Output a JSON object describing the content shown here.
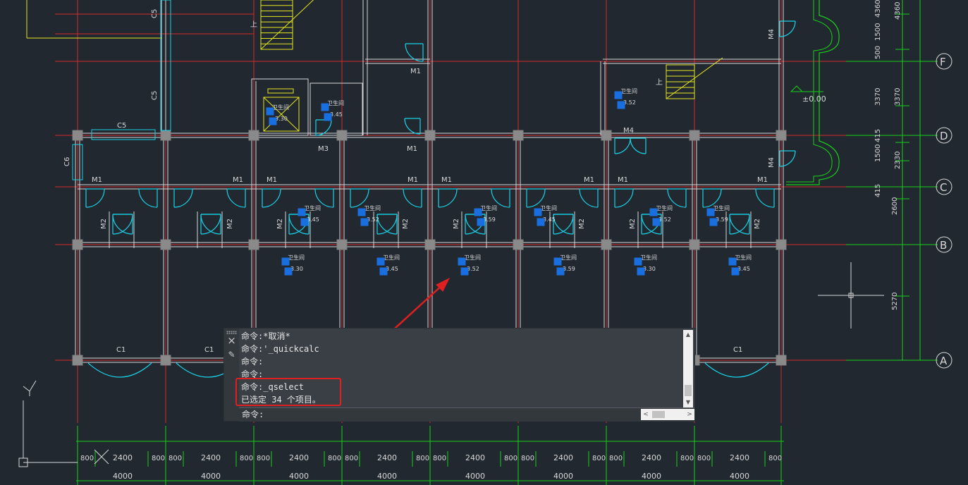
{
  "drawing": {
    "room_labels": {
      "M1": "M1",
      "M2": "M2",
      "M3": "M3",
      "M4": "M4",
      "C1": "C1",
      "C5": "C5",
      "C6": "C6"
    },
    "stair_label": "上",
    "level_mark": "±0.00",
    "grid_bubbles": [
      "F",
      "D",
      "C",
      "B",
      "A"
    ],
    "right_dims_outer": [
      "4360",
      "1500",
      "500",
      "3370",
      "415",
      "1500",
      "415",
      "2600",
      "5270"
    ],
    "right_dims_inner": [
      "4360",
      "3370",
      "2330"
    ],
    "bottom_dims_detail": [
      "800",
      "2400",
      "800"
    ],
    "bottom_dims_bay": "4000",
    "room_tag_codes": [
      "3.30",
      "3.45",
      "3.52",
      "3.59"
    ]
  },
  "command_window": {
    "close_icon": "×",
    "edit_icon": "✎",
    "history": [
      "命令:*取消*",
      "命令:'_quickcalc",
      "命令:",
      "命令:",
      "命令:_qselect",
      "已选定 34 个项目。"
    ],
    "prompt": "命令:",
    "scroll_up": "▲",
    "scroll_down": "▼",
    "scroll_left": "<",
    "scroll_right": ">"
  },
  "colors": {
    "background": "#212830",
    "grid_red": "#d42a2a",
    "wall": "#d8d8d8",
    "door_cyan": "#19d2e6",
    "dim_green": "#18d018",
    "stair_yellow": "#e6e61e",
    "grip_blue": "#1a6fe0",
    "callout_red": "#e02020"
  }
}
